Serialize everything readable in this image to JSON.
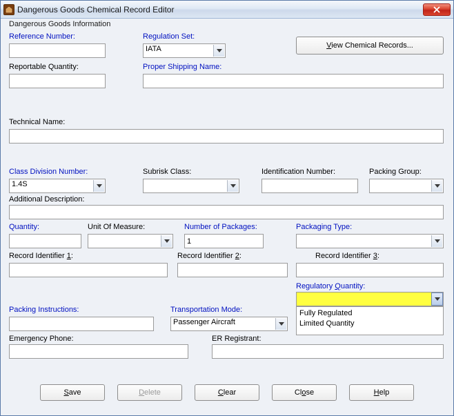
{
  "window": {
    "title": "Dangerous Goods Chemical Record Editor"
  },
  "group_title": "Dangerous Goods Information",
  "labels": {
    "reference_number": "Reference Number:",
    "regulation_set": "Regulation Set:",
    "reportable_quantity": "Reportable Quantity:",
    "proper_shipping_name": "Proper Shipping Name:",
    "technical_name": "Technical Name:",
    "class_division_number": "Class Division Number:",
    "subrisk_class": "Subrisk Class:",
    "identification_number": "Identification Number:",
    "packing_group": "Packing Group:",
    "additional_description": "Additional Description:",
    "quantity": "Quantity:",
    "unit_of_measure": "Unit Of Measure:",
    "number_of_packages": "Number of Packages:",
    "packaging_type": "Packaging Type:",
    "record_identifier_1_pre": "Record Identifier ",
    "record_identifier_1_u": "1",
    "record_identifier_2_pre": "Record Identifier ",
    "record_identifier_2_u": "2",
    "record_identifier_3_pre": "Record Identifier ",
    "record_identifier_3_u": "3",
    "regulatory_quantity_pre": "Regulatory ",
    "regulatory_quantity_u": "Q",
    "regulatory_quantity_post": "uantity:",
    "packing_instructions": "Packing Instructions:",
    "transportation_mode": "Transportation Mode:",
    "emergency_phone": "Emergency Phone:",
    "er_registrant": "ER Registrant:"
  },
  "values": {
    "reference_number": "",
    "regulation_set": "IATA",
    "reportable_quantity": "",
    "proper_shipping_name": "",
    "technical_name": "",
    "class_division_number": "1.4S",
    "subrisk_class": "",
    "identification_number": "",
    "packing_group": "",
    "additional_description": "",
    "quantity": "",
    "unit_of_measure": "",
    "number_of_packages": "1",
    "packaging_type": "",
    "record_identifier_1": "",
    "record_identifier_2": "",
    "record_identifier_3": "",
    "regulatory_quantity": "",
    "packing_instructions": "",
    "transportation_mode": "Passenger Aircraft",
    "emergency_phone": "",
    "er_registrant": ""
  },
  "regulatory_quantity_options": [
    "Fully Regulated",
    "Limited Quantity"
  ],
  "buttons": {
    "view_chemical_u": "V",
    "view_chemical_post": "iew Chemical Records...",
    "save_u": "S",
    "save_post": "ave",
    "delete_u": "D",
    "delete_post": "elete",
    "clear_u": "C",
    "clear_post": "lear",
    "close_pre": "Cl",
    "close_u": "o",
    "close_post": "se",
    "help_u": "H",
    "help_post": "elp"
  }
}
